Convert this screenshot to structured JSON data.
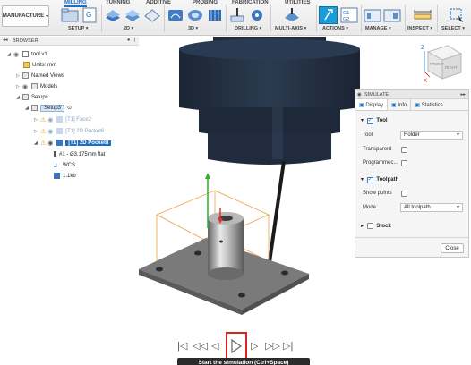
{
  "toolbar": {
    "workspace": "MANUFACTURE",
    "tabs": [
      "MILLING",
      "TURNING",
      "ADDITIVE",
      "PROBING",
      "FABRICATION",
      "UTILITIES"
    ],
    "groups": [
      "SETUP",
      "2D",
      "3D",
      "DRILLING",
      "MULTI-AXIS",
      "ACTIONS",
      "MANAGE",
      "INSPECT",
      "SELECT"
    ],
    "ncode": "G1\nG2",
    "accent": "#1b6fc4"
  },
  "browser": {
    "title": "BROWSER",
    "items": [
      {
        "label": "tool v1"
      },
      {
        "label": "Units: mm"
      },
      {
        "label": "Named Views"
      },
      {
        "label": "Models"
      },
      {
        "label": "Setups"
      },
      {
        "label": "Setup3"
      },
      {
        "label": "[T1] Face2"
      },
      {
        "label": "[T1] 2D Pocket6"
      },
      {
        "label": "[T1] 2D Pocket8"
      },
      {
        "label": "#1 - Ø3.175mm flat"
      },
      {
        "label": "WCS"
      },
      {
        "label": "1.1kb"
      }
    ]
  },
  "simulate": {
    "title": "SIMULATE",
    "tabs": [
      "Display",
      "Info",
      "Statistics"
    ],
    "tool_section": "Tool",
    "tool_label": "Tool",
    "tool_value": "Holder",
    "transparent_label": "Transparent",
    "programmed_label": "Programmec...",
    "toolpath_section": "Toolpath",
    "show_points_label": "Show points",
    "mode_label": "Mode",
    "mode_value": "All toolpath",
    "stock_section": "Stock",
    "close_label": "Close"
  },
  "viewcube": {
    "front": "FRONT",
    "right": "RIGHT",
    "axis_x": "X",
    "axis_z": "Z"
  },
  "playback": {
    "tooltip": "Start the simulation (Ctrl+Space)"
  }
}
